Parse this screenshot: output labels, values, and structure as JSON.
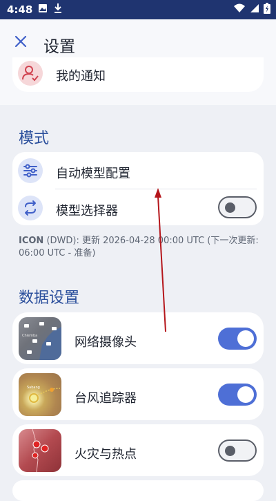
{
  "status_bar": {
    "time": "4:48"
  },
  "header": {
    "title": "设置"
  },
  "notifications": {
    "label": "我的通知"
  },
  "mode_section": {
    "title": "模式",
    "items": [
      {
        "label": "自动模型配置",
        "icon": "sliders-icon"
      },
      {
        "label": "模型选择器",
        "icon": "swap-icon",
        "toggle": "off"
      }
    ],
    "info_model": "ICON",
    "info_text": " (DWD): 更新 2026-04-28 00:00 UTC (下一次更新: 06:00 UTC - 准备)"
  },
  "data_section": {
    "title": "数据设置",
    "items": [
      {
        "label": "网络摄像头",
        "toggle": "on",
        "thumb_label": "Chiemba"
      },
      {
        "label": "台风追踪器",
        "toggle": "on",
        "thumb_label": "Sabang"
      },
      {
        "label": "火灾与热点",
        "toggle": "off"
      }
    ]
  },
  "colors": {
    "accent": "#4e6fd6",
    "status_bar": "#1f3470",
    "annotation_arrow": "#b5161b"
  }
}
